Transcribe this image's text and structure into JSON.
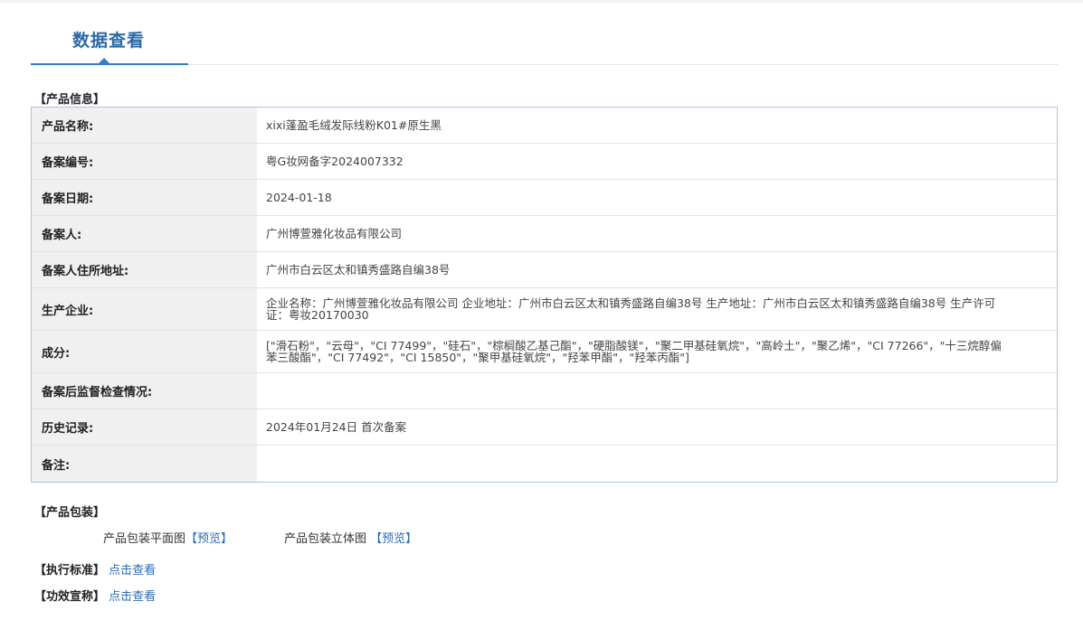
{
  "tab": {
    "title": "数据查看"
  },
  "product_info": {
    "section_title": "【产品信息】",
    "rows": [
      {
        "label": "产品名称:",
        "value": "xixi蓬盈毛绒发际线粉K01#原生黑"
      },
      {
        "label": "备案编号:",
        "value": "粤G妆网备字2024007332"
      },
      {
        "label": "备案日期:",
        "value": "2024-01-18"
      },
      {
        "label": "备案人:",
        "value": "广州博萱雅化妆品有限公司"
      },
      {
        "label": "备案人住所地址:",
        "value": "广州市白云区太和镇秀盛路自编38号"
      },
      {
        "label": "生产企业:",
        "value": "企业名称：广州博萱雅化妆品有限公司 企业地址：广州市白云区太和镇秀盛路自编38号 生产地址：广州市白云区太和镇秀盛路自编38号 生产许可证：粤妆20170030"
      },
      {
        "label": "成分:",
        "value": "[\"滑石粉\"，\"云母\"，\"CI 77499\"，\"硅石\"，\"棕榈酸乙基己酯\"，\"硬脂酸镁\"，\"聚二甲基硅氧烷\"，\"高岭土\"，\"聚乙烯\"，\"CI 77266\"，\"十三烷醇偏苯三酸酯\"，\"CI 77492\"，\"CI 15850\"，\"聚甲基硅氧烷\"，\"羟苯甲酯\"，\"羟苯丙酯\"]"
      },
      {
        "label": "备案后监督检查情况:",
        "value": ""
      },
      {
        "label": "历史记录:",
        "value": "2024年01月24日 首次备案"
      },
      {
        "label": "备注:",
        "value": ""
      }
    ]
  },
  "packaging": {
    "section_title": "【产品包装】",
    "flat_label": "产品包装平面图",
    "flat_link": "【预览】",
    "solid_label": "产品包装立体图",
    "solid_link": "【预览】"
  },
  "standard": {
    "label": "【执行标准】",
    "link": "点击查看"
  },
  "efficacy": {
    "label": "【功效宣称】",
    "link": "点击查看"
  }
}
